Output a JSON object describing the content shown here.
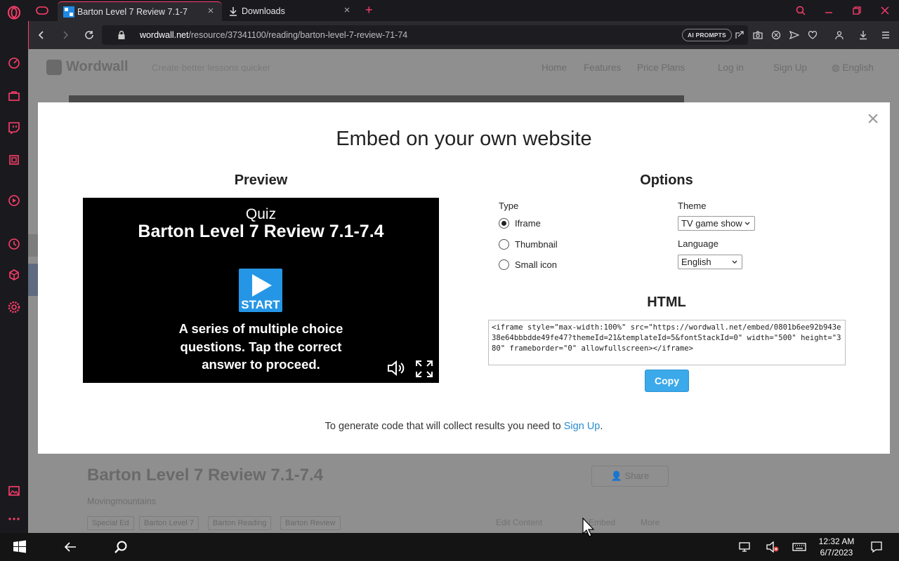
{
  "browser": {
    "tabs": [
      {
        "title": "Barton Level 7 Review 7.1-7",
        "active": true
      },
      {
        "title": "Downloads",
        "active": false
      }
    ],
    "new_tab_symbol": "+",
    "close_symbol": "×",
    "url": {
      "host": "wordwall.net",
      "path": "/resource/37341100/reading/barton-level-7-review-71-74"
    },
    "ai_prompts_label": "AI PROMPTS",
    "accent_color": "#ff3d6b"
  },
  "page": {
    "logo_text": "Wordwall",
    "tagline": "Create better lessons quicker",
    "nav": [
      "Home",
      "Features",
      "Price Plans",
      "Log in",
      "Sign Up"
    ],
    "language": "English",
    "activity_title": "Barton Level 7 Review 7.1-7.4",
    "share_label": "Share",
    "author": "Movingmountains",
    "tags": [
      "Special Ed",
      "Barton Level 7",
      "Barton Reading",
      "Barton Review"
    ],
    "actions": [
      "Edit Content",
      "Embed",
      "More"
    ]
  },
  "modal": {
    "title": "Embed on your own website",
    "close_symbol": "×",
    "preview": {
      "heading": "Preview",
      "activity_type": "Quiz",
      "activity_title": "Barton Level 7 Review 7.1-7.4",
      "start_label": "START",
      "description": "A series of multiple choice questions. Tap the correct answer to proceed."
    },
    "options": {
      "heading": "Options",
      "type_label": "Type",
      "types": [
        {
          "label": "Iframe",
          "checked": true
        },
        {
          "label": "Thumbnail",
          "checked": false
        },
        {
          "label": "Small icon",
          "checked": false
        }
      ],
      "theme_label": "Theme",
      "theme_value": "TV game show",
      "language_label": "Language",
      "language_value": "English"
    },
    "html": {
      "heading": "HTML",
      "code": "<iframe style=\"max-width:100%\" src=\"https://wordwall.net/embed/0801b6ee92b943e38e64bbbdde49fe47?themeId=21&templateId=5&fontStackId=0\" width=\"500\" height=\"380\" frameborder=\"0\" allowfullscreen></iframe>",
      "copy_label": "Copy",
      "copy_color": "#3ba9ea"
    },
    "footer": {
      "text_before": "To generate code that will collect results you need to ",
      "link": "Sign Up",
      "text_after": "."
    }
  },
  "taskbar": {
    "time": "12:32 AM",
    "date": "6/7/2023"
  }
}
